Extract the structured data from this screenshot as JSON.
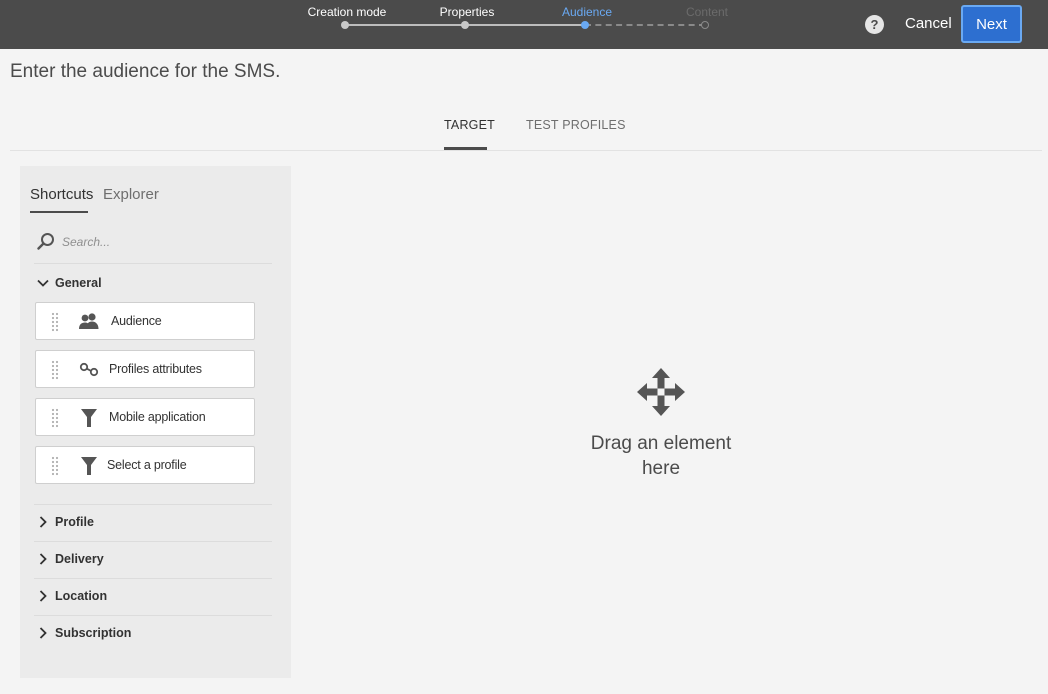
{
  "wizard": {
    "steps": [
      {
        "label": "Creation mode",
        "state": "done"
      },
      {
        "label": "Properties",
        "state": "done"
      },
      {
        "label": "Audience",
        "state": "active"
      },
      {
        "label": "Content",
        "state": "future"
      }
    ],
    "help_icon": "question-mark-icon",
    "cancel_label": "Cancel",
    "next_label": "Next"
  },
  "page": {
    "heading": "Enter the audience for the SMS."
  },
  "tabs": [
    {
      "label": "TARGET",
      "selected": true
    },
    {
      "label": "TEST PROFILES",
      "selected": false
    }
  ],
  "panel": {
    "tabs": [
      {
        "label": "Shortcuts",
        "selected": true
      },
      {
        "label": "Explorer",
        "selected": false
      }
    ],
    "search": {
      "placeholder": "Search..."
    },
    "sections": [
      {
        "label": "General",
        "expanded": true,
        "items": [
          {
            "label": "Audience",
            "icon": "audience-icon"
          },
          {
            "label": "Profiles attributes",
            "icon": "attributes-icon"
          },
          {
            "label": "Mobile application",
            "icon": "filter-icon"
          },
          {
            "label": "Select a profile",
            "icon": "filter-icon"
          }
        ]
      },
      {
        "label": "Profile",
        "expanded": false
      },
      {
        "label": "Delivery",
        "expanded": false
      },
      {
        "label": "Location",
        "expanded": false
      },
      {
        "label": "Subscription",
        "expanded": false
      }
    ]
  },
  "dropzone": {
    "text_line1": "Drag an element",
    "text_line2": "here",
    "icon": "move-arrows-icon"
  },
  "colors": {
    "topbar": "#4b4b4b",
    "accent": "#2d6fd0",
    "active_step": "#6aa9f2"
  }
}
